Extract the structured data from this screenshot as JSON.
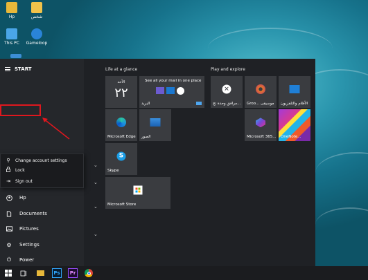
{
  "desktop": {
    "icons": [
      {
        "label": "Hp",
        "icon": "folder-icon"
      },
      {
        "label": "شخص",
        "icon": "user-folder-icon"
      },
      {
        "label": "This PC",
        "icon": "computer-icon"
      },
      {
        "label": "Gameloop",
        "icon": "gameloop-icon"
      }
    ]
  },
  "start": {
    "title": "START",
    "flyout": {
      "change_account": "Change account settings",
      "lock": "Lock",
      "sign_out": "Sign out"
    },
    "rail_items": [
      {
        "label": "Hp",
        "icon": "user-icon"
      },
      {
        "label": "Documents",
        "icon": "document-icon"
      },
      {
        "label": "Pictures",
        "icon": "pictures-icon"
      },
      {
        "label": "Settings",
        "icon": "gear-icon"
      },
      {
        "label": "Power",
        "icon": "power-icon"
      }
    ],
    "sections": {
      "life": "Life at a glance",
      "play": "Play and explore"
    },
    "tiles": {
      "calendar": {
        "day_name": "الأحد",
        "day_number": "٢٢"
      },
      "mail": {
        "text": "See all your mail in one place",
        "label": "البريد"
      },
      "edge": {
        "label": "Microsoft Edge"
      },
      "photos": {
        "label": "الصور"
      },
      "skype": {
        "label": "Skype"
      },
      "store": {
        "label": "Microsoft Store"
      },
      "xbox": {
        "label": "مرافق وحدة تح..."
      },
      "groove": {
        "label": "Groo... موسيقى"
      },
      "movies": {
        "label": "الأفلام والتلفزيون"
      },
      "office": {
        "label": "Microsoft 365..."
      },
      "onenote": {
        "label": "OneNote..."
      }
    }
  },
  "taskbar": {
    "apps": [
      {
        "name": "start-button"
      },
      {
        "name": "task-view-icon"
      },
      {
        "name": "file-explorer-icon"
      },
      {
        "name": "photoshop-icon",
        "text": "Ps"
      },
      {
        "name": "premiere-icon",
        "text": "Pr"
      },
      {
        "name": "chrome-icon"
      }
    ]
  }
}
